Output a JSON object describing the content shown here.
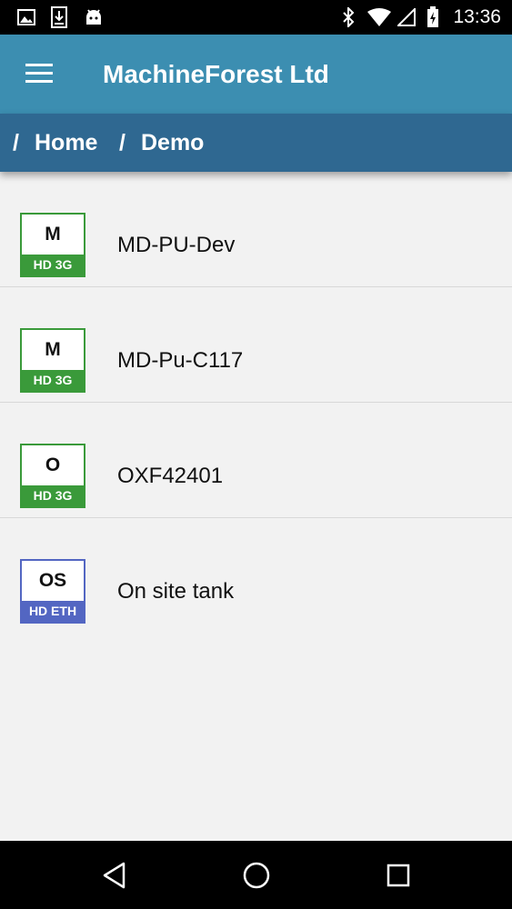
{
  "status_bar": {
    "time": "13:36",
    "icons": [
      "image-icon",
      "download-icon",
      "android-icon",
      "bluetooth-icon",
      "wifi-icon",
      "signal-icon",
      "battery-icon"
    ]
  },
  "app_bar": {
    "title": "MachineForest Ltd",
    "menu_icon": "hamburger-icon"
  },
  "breadcrumb": {
    "separator": "/",
    "items": [
      "Home",
      "Demo"
    ]
  },
  "devices": [
    {
      "badge_letter": "M",
      "badge_type": "HD 3G",
      "name": "MD-PU-Dev",
      "badge_color": "#3a9a3a"
    },
    {
      "badge_letter": "M",
      "badge_type": "HD 3G",
      "name": "MD-Pu-C117",
      "badge_color": "#3a9a3a"
    },
    {
      "badge_letter": "O",
      "badge_type": "HD 3G",
      "name": "OXF42401",
      "badge_color": "#3a9a3a"
    },
    {
      "badge_letter": "OS",
      "badge_type": "HD ETH",
      "name": "On site tank",
      "badge_color": "#5366c2"
    }
  ],
  "nav_bar": {
    "buttons": [
      "back-icon",
      "home-icon",
      "recents-icon"
    ]
  },
  "colors": {
    "app_bar": "#3c8eb1",
    "breadcrumb_bar": "#2f6891",
    "badge_green": "#3a9a3a",
    "badge_blue": "#5366c2",
    "background": "#f2f2f2"
  }
}
